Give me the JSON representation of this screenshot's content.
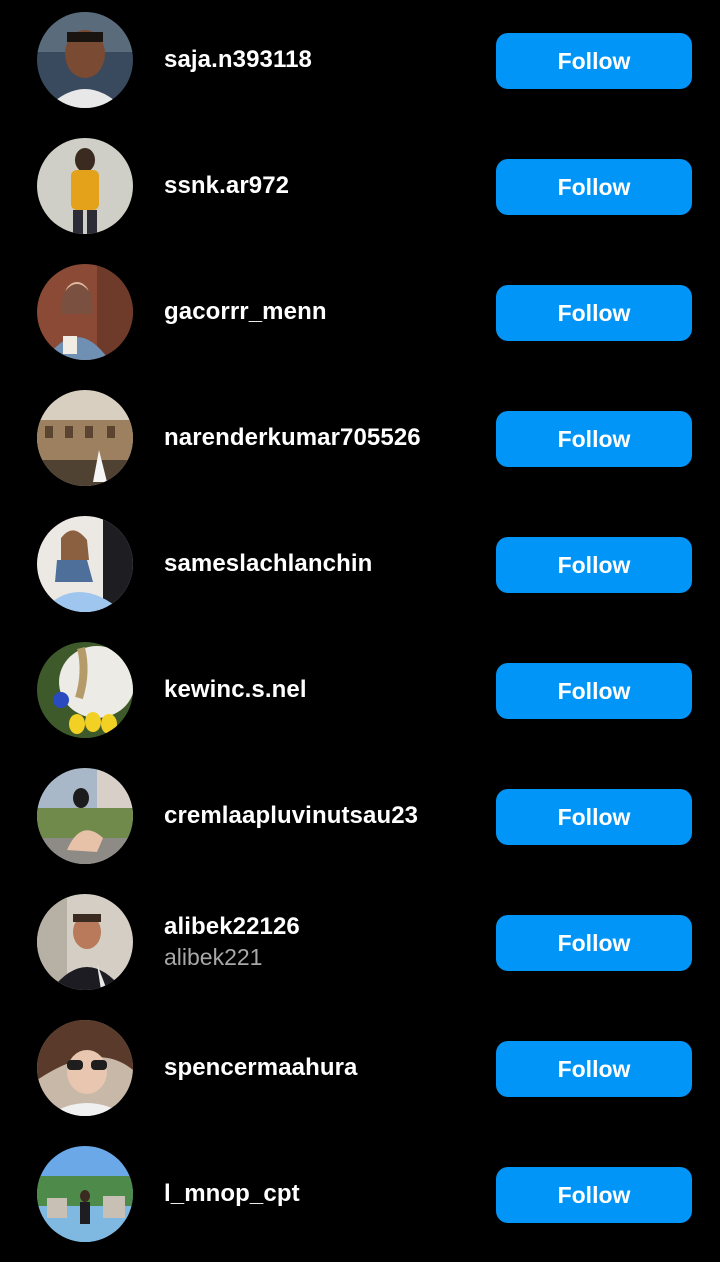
{
  "colors": {
    "background": "#000000",
    "follow_button": "#0095f6",
    "username": "#ffffff",
    "subname": "#a8a8a8"
  },
  "users": [
    {
      "username": "saja.n393118",
      "subname": "",
      "button_label": "Follow"
    },
    {
      "username": "ssnk.ar972",
      "subname": "",
      "button_label": "Follow"
    },
    {
      "username": "gacorrr_menn",
      "subname": "",
      "button_label": "Follow"
    },
    {
      "username": "narenderkumar705526",
      "subname": "",
      "button_label": "Follow"
    },
    {
      "username": "sameslachlanchin",
      "subname": "",
      "button_label": "Follow"
    },
    {
      "username": "kewinc.s.nel",
      "subname": "",
      "button_label": "Follow"
    },
    {
      "username": "cremlaapluvinutsau23",
      "subname": "",
      "button_label": "Follow"
    },
    {
      "username": "alibek22126",
      "subname": "alibek221",
      "button_label": "Follow"
    },
    {
      "username": "spencermaahura",
      "subname": "",
      "button_label": "Follow"
    },
    {
      "username": "l_mnop_cpt",
      "subname": "",
      "button_label": "Follow"
    }
  ]
}
